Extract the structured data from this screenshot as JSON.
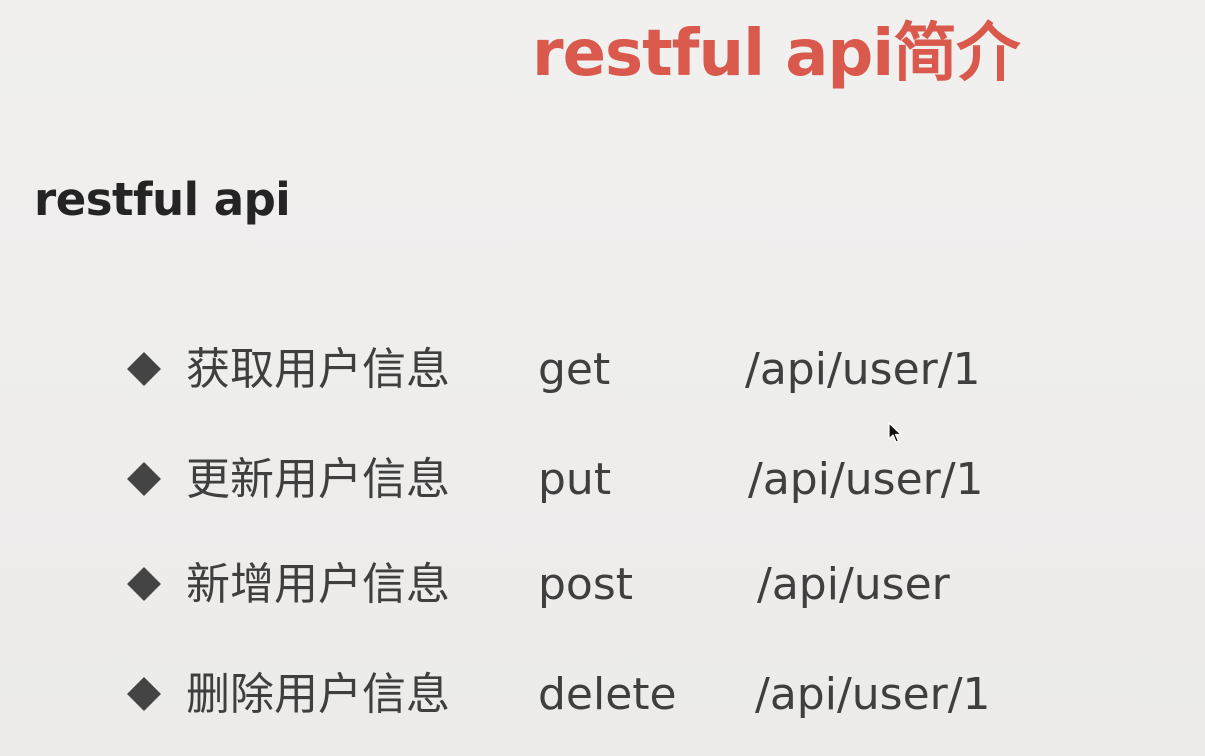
{
  "slide": {
    "title": "restful api简介",
    "subtitle": "restful api",
    "title_color": "#d9594c",
    "text_color": "#3f3f3f",
    "bullet_icon": "diamond-bullet-icon",
    "cursor_icon": "mouse-pointer-icon",
    "items": [
      {
        "description": "获取用户信息",
        "method": "get",
        "path": "/api/user/1"
      },
      {
        "description": "更新用户信息",
        "method": "put",
        "path": "/api/user/1"
      },
      {
        "description": "新增用户信息",
        "method": "post",
        "path": "/api/user"
      },
      {
        "description": "删除用户信息",
        "method": "delete",
        "path": "/api/user/1"
      }
    ]
  }
}
